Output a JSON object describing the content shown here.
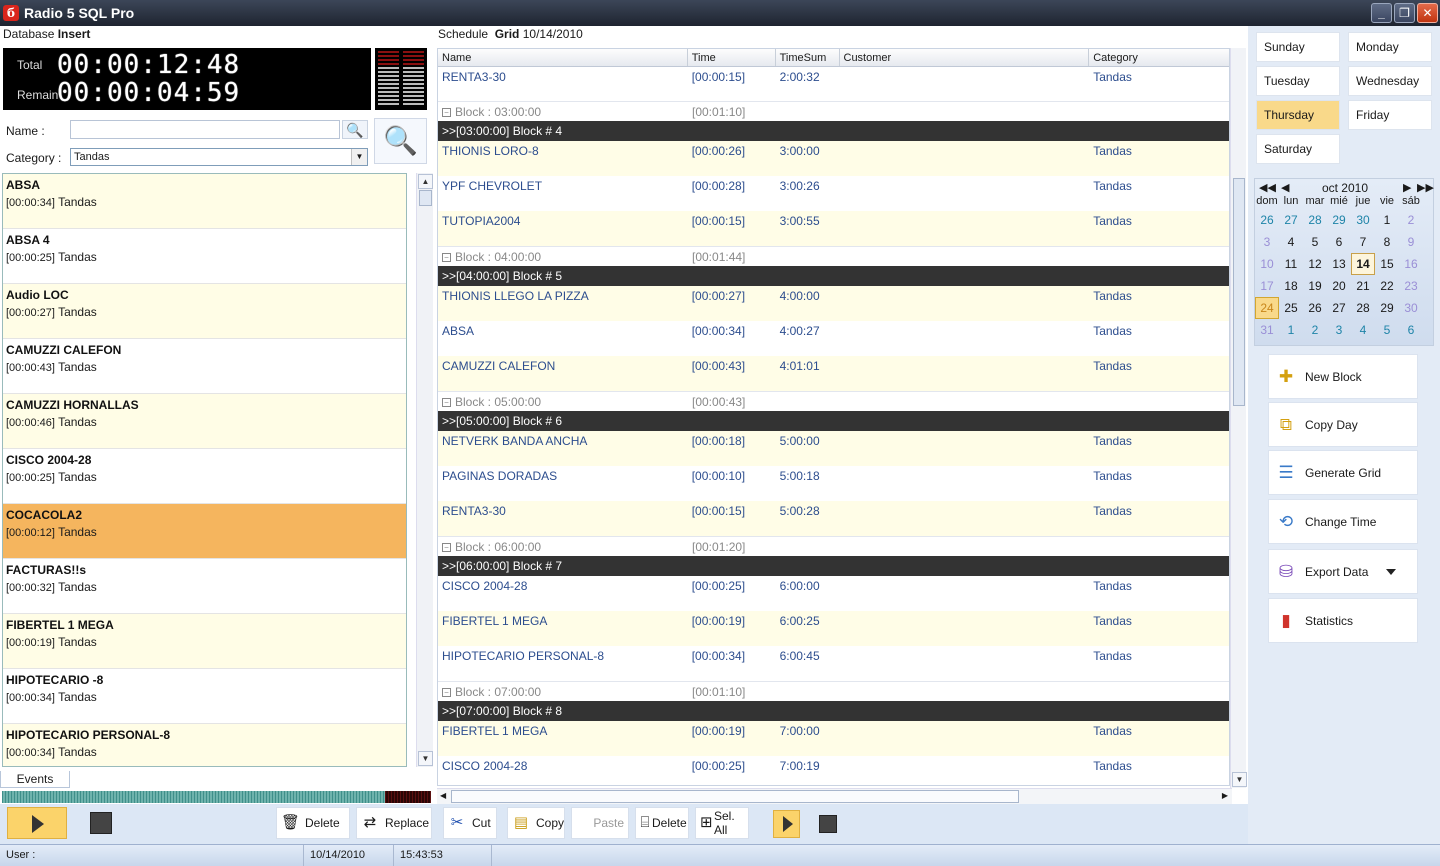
{
  "app": {
    "title": "Radio 5 SQL Pro",
    "icon_glyph": "б"
  },
  "window_buttons": {
    "minimize": "_",
    "restore": "❐",
    "close": "✕"
  },
  "database": {
    "label": "Database",
    "value": "Insert"
  },
  "timers": {
    "total_label": "Total",
    "total_value": "00:00:12:48",
    "remain_label": "Remain",
    "remain_value": "00:00:04:59"
  },
  "search": {
    "name_label": "Name :",
    "name_value": "",
    "category_label": "Category :",
    "category_value": "Tandas"
  },
  "events": [
    {
      "name": "ABSA",
      "duration": "[00:00:34]",
      "category": "Tandas"
    },
    {
      "name": "ABSA 4",
      "duration": "[00:00:25]",
      "category": "Tandas"
    },
    {
      "name": "Audio LOC",
      "duration": "[00:00:27]",
      "category": "Tandas"
    },
    {
      "name": "CAMUZZI CALEFON",
      "duration": "[00:00:43]",
      "category": "Tandas"
    },
    {
      "name": "CAMUZZI HORNALLAS",
      "duration": "[00:00:46]",
      "category": "Tandas"
    },
    {
      "name": "CISCO 2004-28",
      "duration": "[00:00:25]",
      "category": "Tandas"
    },
    {
      "name": "COCACOLA2",
      "duration": "[00:00:12]",
      "category": "Tandas"
    },
    {
      "name": "FACTURAS!!s",
      "duration": "[00:00:32]",
      "category": "Tandas"
    },
    {
      "name": "FIBERTEL 1 MEGA",
      "duration": "[00:00:19]",
      "category": "Tandas"
    },
    {
      "name": "HIPOTECARIO -8",
      "duration": "[00:00:34]",
      "category": "Tandas"
    },
    {
      "name": "HIPOTECARIO PERSONAL-8",
      "duration": "[00:00:34]",
      "category": "Tandas"
    }
  ],
  "events_tab": "Events",
  "left_toolbar": {
    "delete": "Delete",
    "replace": "Replace"
  },
  "schedule": {
    "label": "Schedule",
    "mode": "Grid",
    "date": "10/14/2010"
  },
  "grid_columns": {
    "name": "Name",
    "time": "Time",
    "timesum": "TimeSum",
    "customer": "Customer",
    "category": "Category"
  },
  "grid": {
    "r0": {
      "name": "RENTA3-30",
      "time": "[00:00:15]",
      "sum": "2:00:32",
      "cust": "",
      "cat": "Tandas"
    },
    "f3": {
      "label": "Block : 03:00:00",
      "time": "[00:01:10]"
    },
    "h4": ">>[03:00:00] Block # 4",
    "r1": {
      "name": "THIONIS LORO-8",
      "time": "[00:00:26]",
      "sum": "3:00:00",
      "cust": "",
      "cat": "Tandas"
    },
    "r2": {
      "name": "YPF CHEVROLET",
      "time": "[00:00:28]",
      "sum": "3:00:26",
      "cust": "",
      "cat": "Tandas"
    },
    "r3": {
      "name": "TUTOPIA2004",
      "time": "[00:00:15]",
      "sum": "3:00:55",
      "cust": "",
      "cat": "Tandas"
    },
    "f4": {
      "label": "Block : 04:00:00",
      "time": "[00:01:44]"
    },
    "h5": ">>[04:00:00] Block # 5",
    "r4": {
      "name": "THIONIS LLEGO LA PIZZA",
      "time": "[00:00:27]",
      "sum": "4:00:00",
      "cust": "",
      "cat": "Tandas"
    },
    "r5": {
      "name": "ABSA",
      "time": "[00:00:34]",
      "sum": "4:00:27",
      "cust": "",
      "cat": "Tandas"
    },
    "r6": {
      "name": "CAMUZZI CALEFON",
      "time": "[00:00:43]",
      "sum": "4:01:01",
      "cust": "",
      "cat": "Tandas"
    },
    "f5": {
      "label": "Block : 05:00:00",
      "time": "[00:00:43]"
    },
    "h6": ">>[05:00:00] Block # 6",
    "r7": {
      "name": "NETVERK BANDA ANCHA",
      "time": "[00:00:18]",
      "sum": "5:00:00",
      "cust": "",
      "cat": "Tandas"
    },
    "r8": {
      "name": "PAGINAS DORADAS",
      "time": "[00:00:10]",
      "sum": "5:00:18",
      "cust": "",
      "cat": "Tandas"
    },
    "r9": {
      "name": "RENTA3-30",
      "time": "[00:00:15]",
      "sum": "5:00:28",
      "cust": "",
      "cat": "Tandas"
    },
    "f6": {
      "label": "Block : 06:00:00",
      "time": "[00:01:20]"
    },
    "h7": ">>[06:00:00] Block # 7",
    "r10": {
      "name": "CISCO 2004-28",
      "time": "[00:00:25]",
      "sum": "6:00:00",
      "cust": "",
      "cat": "Tandas"
    },
    "r11": {
      "name": "FIBERTEL 1 MEGA",
      "time": "[00:00:19]",
      "sum": "6:00:25",
      "cust": "",
      "cat": "Tandas"
    },
    "r12": {
      "name": "HIPOTECARIO PERSONAL-8",
      "time": "[00:00:34]",
      "sum": "6:00:45",
      "cust": "",
      "cat": "Tandas"
    },
    "f7": {
      "label": "Block : 07:00:00",
      "time": "[00:01:10]"
    },
    "h8": ">>[07:00:00] Block # 8",
    "r13": {
      "name": "FIBERTEL 1 MEGA",
      "time": "[00:00:19]",
      "sum": "7:00:00",
      "cust": "",
      "cat": "Tandas"
    },
    "r14": {
      "name": "CISCO 2004-28",
      "time": "[00:00:25]",
      "sum": "7:00:19",
      "cust": "",
      "cat": "Tandas"
    }
  },
  "center_toolbar": {
    "cut": "Cut",
    "copy": "Copy",
    "paste": "Paste",
    "delete": "Delete",
    "select_all": "Sel. All"
  },
  "days": {
    "sunday": "Sunday",
    "monday": "Monday",
    "tuesday": "Tuesday",
    "wednesday": "Wednesday",
    "thursday": "Thursday",
    "friday": "Friday",
    "saturday": "Saturday"
  },
  "calendar": {
    "title": "oct 2010",
    "dows": [
      "dom",
      "lun",
      "mar",
      "mié",
      "jue",
      "vie",
      "sáb"
    ],
    "weeks": [
      [
        "26",
        "27",
        "28",
        "29",
        "30",
        "1",
        "2"
      ],
      [
        "3",
        "4",
        "5",
        "6",
        "7",
        "8",
        "9"
      ],
      [
        "10",
        "11",
        "12",
        "13",
        "14",
        "15",
        "16"
      ],
      [
        "17",
        "18",
        "19",
        "20",
        "21",
        "22",
        "23"
      ],
      [
        "24",
        "25",
        "26",
        "27",
        "28",
        "29",
        "30"
      ],
      [
        "31",
        "1",
        "2",
        "3",
        "4",
        "5",
        "6"
      ]
    ]
  },
  "actions": {
    "new_block": "New Block",
    "copy_day": "Copy Day",
    "generate_grid": "Generate Grid",
    "change_time": "Change Time",
    "export_data": "Export Data",
    "statistics": "Statistics"
  },
  "status": {
    "user_label": "User :",
    "date": "10/14/2010",
    "time": "15:43:53"
  },
  "colors": {
    "selected_row": "#f5b55e",
    "active_day": "#f9d98a",
    "block_header": "#333333",
    "item_text": "#2c4d8e"
  }
}
